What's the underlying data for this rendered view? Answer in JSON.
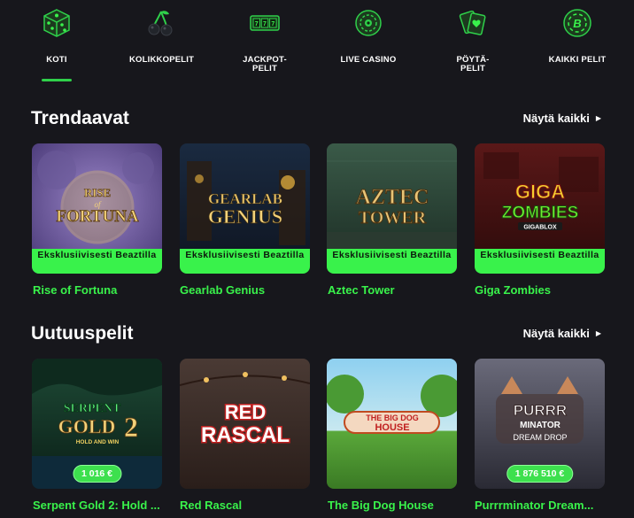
{
  "nav": {
    "items": [
      {
        "label": "KOTI",
        "icon": "dice-icon"
      },
      {
        "label": "KOLIKKOPELIT",
        "icon": "cherries-icon"
      },
      {
        "label": "JACKPOT-PELIT",
        "icon": "slot-reels-icon"
      },
      {
        "label": "LIVE CASINO",
        "icon": "roulette-icon"
      },
      {
        "label": "PÖYTÄ-\nPELIT",
        "icon": "playing-cards-icon"
      },
      {
        "label": "KAIKKI PELIT",
        "icon": "all-games-icon"
      }
    ],
    "active_index": 0
  },
  "trending": {
    "title": "Trendaavat",
    "see_all": "Näytä kaikki",
    "games": [
      {
        "title": "Rise of Fortuna",
        "art_text": "RISE OF FORTUNA",
        "badge": "Eksklusiivisesti Beaztilla"
      },
      {
        "title": "Gearlab Genius",
        "art_text": "GEARLAB GENIUS",
        "badge": "Eksklusiivisesti Beaztilla"
      },
      {
        "title": "Aztec Tower",
        "art_text": "AZTEC TOWER",
        "badge": "Eksklusiivisesti Beaztilla"
      },
      {
        "title": "Giga Zombies",
        "art_text": "GIGA ZOMBIES",
        "badge": "Eksklusiivisesti Beaztilla"
      }
    ]
  },
  "new_games": {
    "title": "Uutuuspelit",
    "see_all": "Näytä kaikki",
    "games": [
      {
        "title": "Serpent Gold 2: Hold ...",
        "art_text": "SERPENT GOLD 2",
        "jackpot": "1 016 €"
      },
      {
        "title": "Red Rascal",
        "art_text": "RED RASCAL",
        "jackpot": ""
      },
      {
        "title": "The Big Dog House",
        "art_text": "THE BIG DOG HOUSE",
        "jackpot": ""
      },
      {
        "title": "Purrrminator Dream...",
        "art_text": "PURRR MINATOR DREAM DROP",
        "jackpot": "1 876 510 €"
      }
    ]
  },
  "colors": {
    "background": "#17171c",
    "accent_green": "#39f24b",
    "text": "#ffffff"
  }
}
